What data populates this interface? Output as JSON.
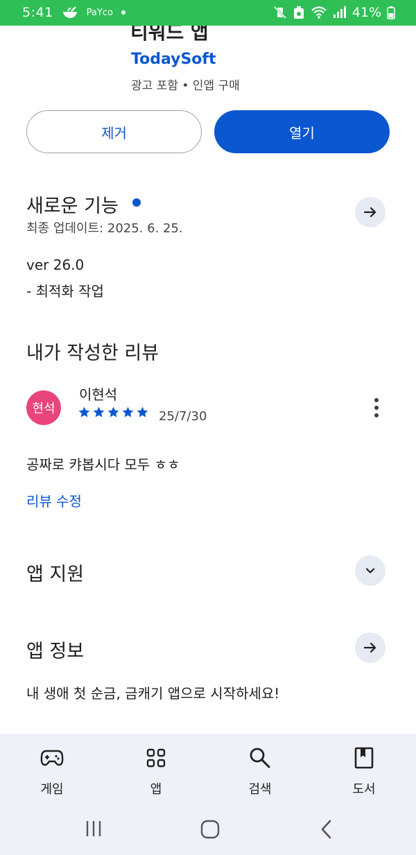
{
  "status_bar": {
    "time": "5:41",
    "carrier_badge": "PaYco",
    "battery": "41%"
  },
  "app": {
    "title": "티워드 앱",
    "developer": "TodaySoft",
    "meta": "광고 포함 • 인앱 구매"
  },
  "actions": {
    "remove_label": "제거",
    "open_label": "열기"
  },
  "whats_new": {
    "title": "새로운 기능",
    "last_updated": "최종 업데이트: 2025. 6. 25.",
    "version": "ver 26.0",
    "notes": "- 최적화 작업"
  },
  "my_review": {
    "title": "내가 작성한 리뷰",
    "avatar_text": "현석",
    "reviewer_name": "이현석",
    "stars": 5,
    "date": "25/7/30",
    "text": "공짜로 캬봅시다 모두 ㅎㅎ",
    "edit_label": "리뷰 수정"
  },
  "app_support": {
    "title": "앱 지원"
  },
  "app_info": {
    "title": "앱 정보",
    "description": "내 생애 첫 순금, 금캐기 앱으로 시작하세요!"
  },
  "bottom_nav": {
    "items": [
      {
        "label": "게임",
        "icon": "gamepad-icon"
      },
      {
        "label": "앱",
        "icon": "apps-grid-icon"
      },
      {
        "label": "검색",
        "icon": "search-icon"
      },
      {
        "label": "도서",
        "icon": "book-icon"
      }
    ]
  },
  "colors": {
    "status_bar": "#2fbf56",
    "accent": "#0b57d0",
    "avatar": "#e8457b",
    "nav_background": "#eef1f7"
  }
}
